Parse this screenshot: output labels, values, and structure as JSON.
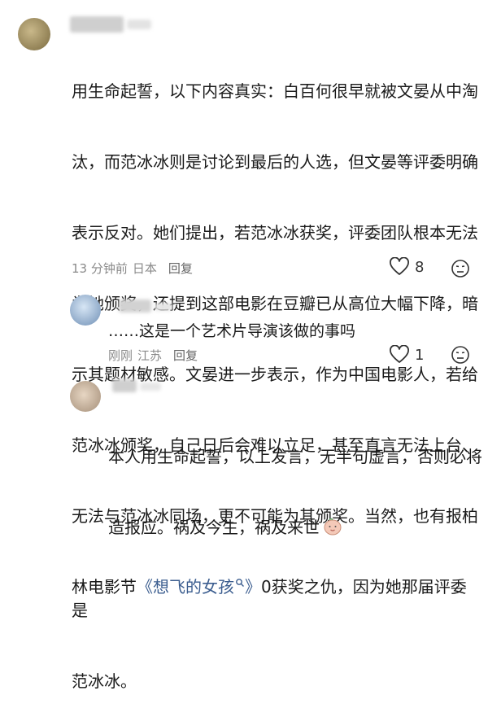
{
  "comments": [
    {
      "lines": [
        "用生命起誓，以下内容真实：白百何很早就被文晏从中淘",
        "汰，而范冰冰则是讨论到最后的人选，但文晏等评委明确",
        "表示反对。她们提出，若范冰冰获奖，评委团队根本无法",
        "为她颁奖，还提到这部电影在豆瓣已从高位大幅下降，暗",
        "示其题材敏感。文晏进一步表示，作为中国电影人，若给",
        "范冰冰颁奖，自己日后会难以立足，甚至直言无法上台、",
        "无法与范冰冰同场，更不可能为其颁奖。当然，也有报柏"
      ],
      "line8_pre": "林电影节",
      "line8_link": "《想飞的女孩",
      "line8_link_close": "》",
      "line8_post": "0获奖之仇，因为她那届评委是",
      "line9": "范冰冰。",
      "time": "13 分钟前",
      "location": "日本",
      "reply": "回复",
      "likes": "8"
    },
    {
      "text": "……这是一个艺术片导演该做的事吗",
      "time": "刚刚",
      "location": "江苏",
      "reply": "回复",
      "likes": "1"
    },
    {
      "lines": [
        "本人用生命起誓，以上发言，无半句虚言，否则必将",
        "造报应。祸及今生，祸及来世"
      ]
    }
  ],
  "icons": {
    "like": "heart-icon",
    "react": "face-icon",
    "search_small": "search-icon",
    "emoji": "emoji-face-icon"
  },
  "colors": {
    "text": "#1a1a1a",
    "meta": "#8a8a8a",
    "link": "#3b5d8f"
  }
}
